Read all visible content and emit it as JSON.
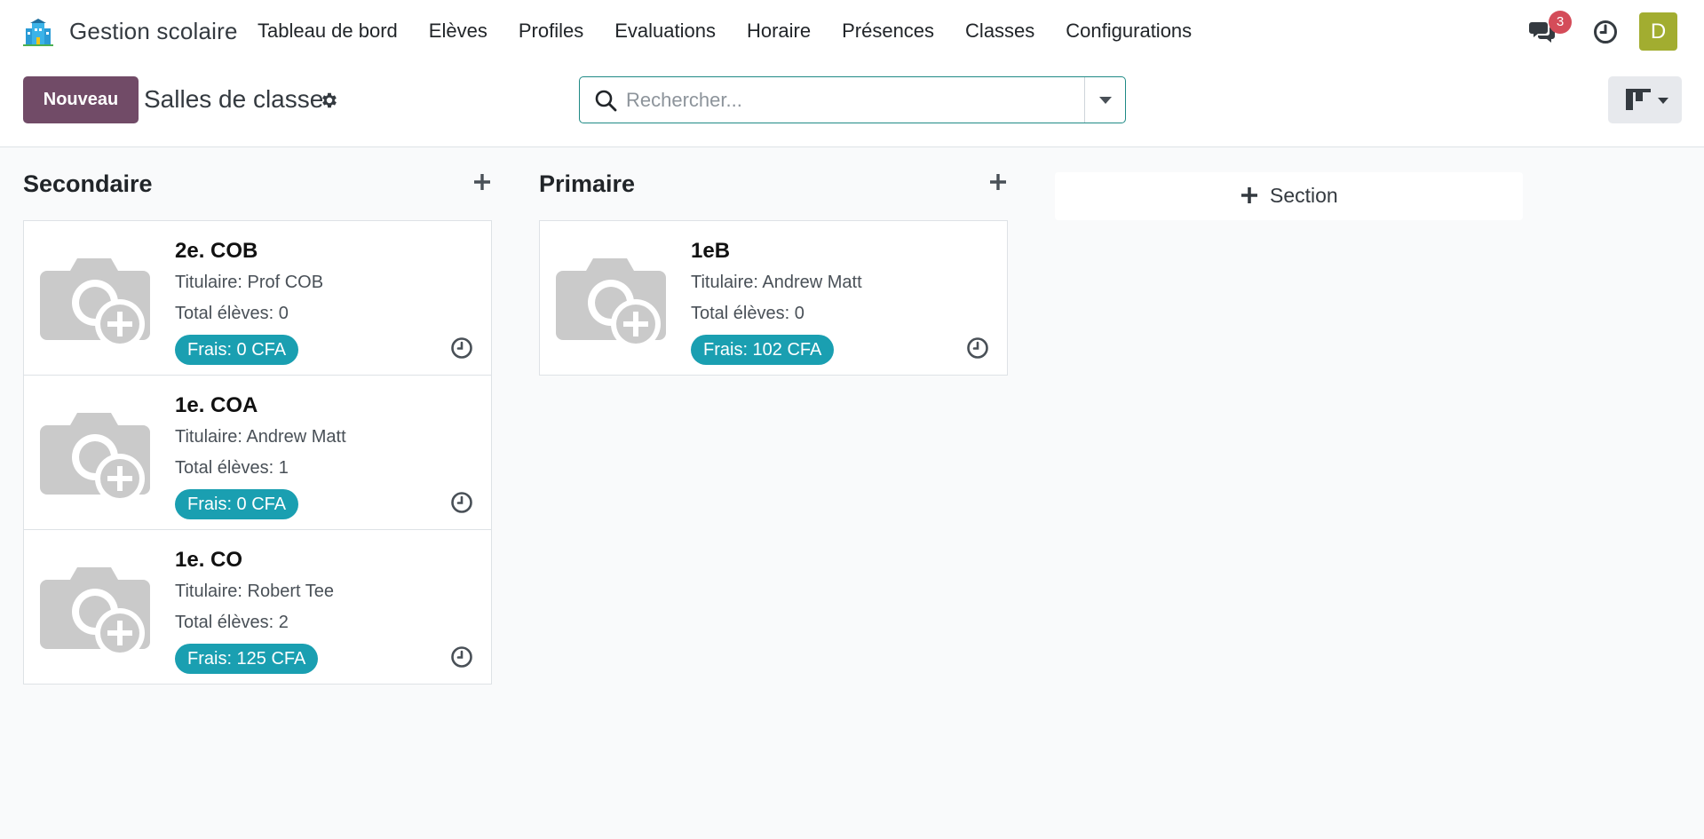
{
  "app": {
    "name": "Gestion scolaire"
  },
  "menu": [
    "Tableau de bord",
    "Elèves",
    "Profiles",
    "Evaluations",
    "Horaire",
    "Présences",
    "Classes",
    "Configurations"
  ],
  "nav": {
    "chat_count": "3",
    "avatar_letter": "D",
    "avatar_color": "#a2ad30",
    "badge_color": "#d44c59"
  },
  "control": {
    "new_label": "Nouveau",
    "breadcrumb": "Salles de classe",
    "search_placeholder": "Rechercher..."
  },
  "colors": {
    "primary": "#714b67",
    "badge": "#1a9fb1",
    "search_border": "#1f8a85"
  },
  "columns": [
    {
      "title": "Secondaire",
      "cards": [
        {
          "name": "2e. COB",
          "titulaire": "Titulaire: Prof COB",
          "total": "Total élèves: 0",
          "frais": "Frais: 0 CFA"
        },
        {
          "name": "1e. COA",
          "titulaire": "Titulaire: Andrew Matt",
          "total": "Total élèves: 1",
          "frais": "Frais: 0 CFA"
        },
        {
          "name": "1e. CO",
          "titulaire": "Titulaire: Robert Tee",
          "total": "Total élèves: 2",
          "frais": "Frais: 125 CFA"
        }
      ]
    },
    {
      "title": "Primaire",
      "cards": [
        {
          "name": "1eB",
          "titulaire": "Titulaire: Andrew Matt",
          "total": "Total élèves: 0",
          "frais": "Frais: 102 CFA"
        }
      ]
    }
  ],
  "add_section_label": "Section",
  "icons": {
    "logo": "school-building-icon",
    "chat": "chat-bubbles-icon",
    "activity": "clock-icon",
    "gear": "gear-icon",
    "search": "search-icon",
    "view": "kanban-view-icon",
    "plus": "plus-icon",
    "placeholder": "camera-plus-icon"
  }
}
